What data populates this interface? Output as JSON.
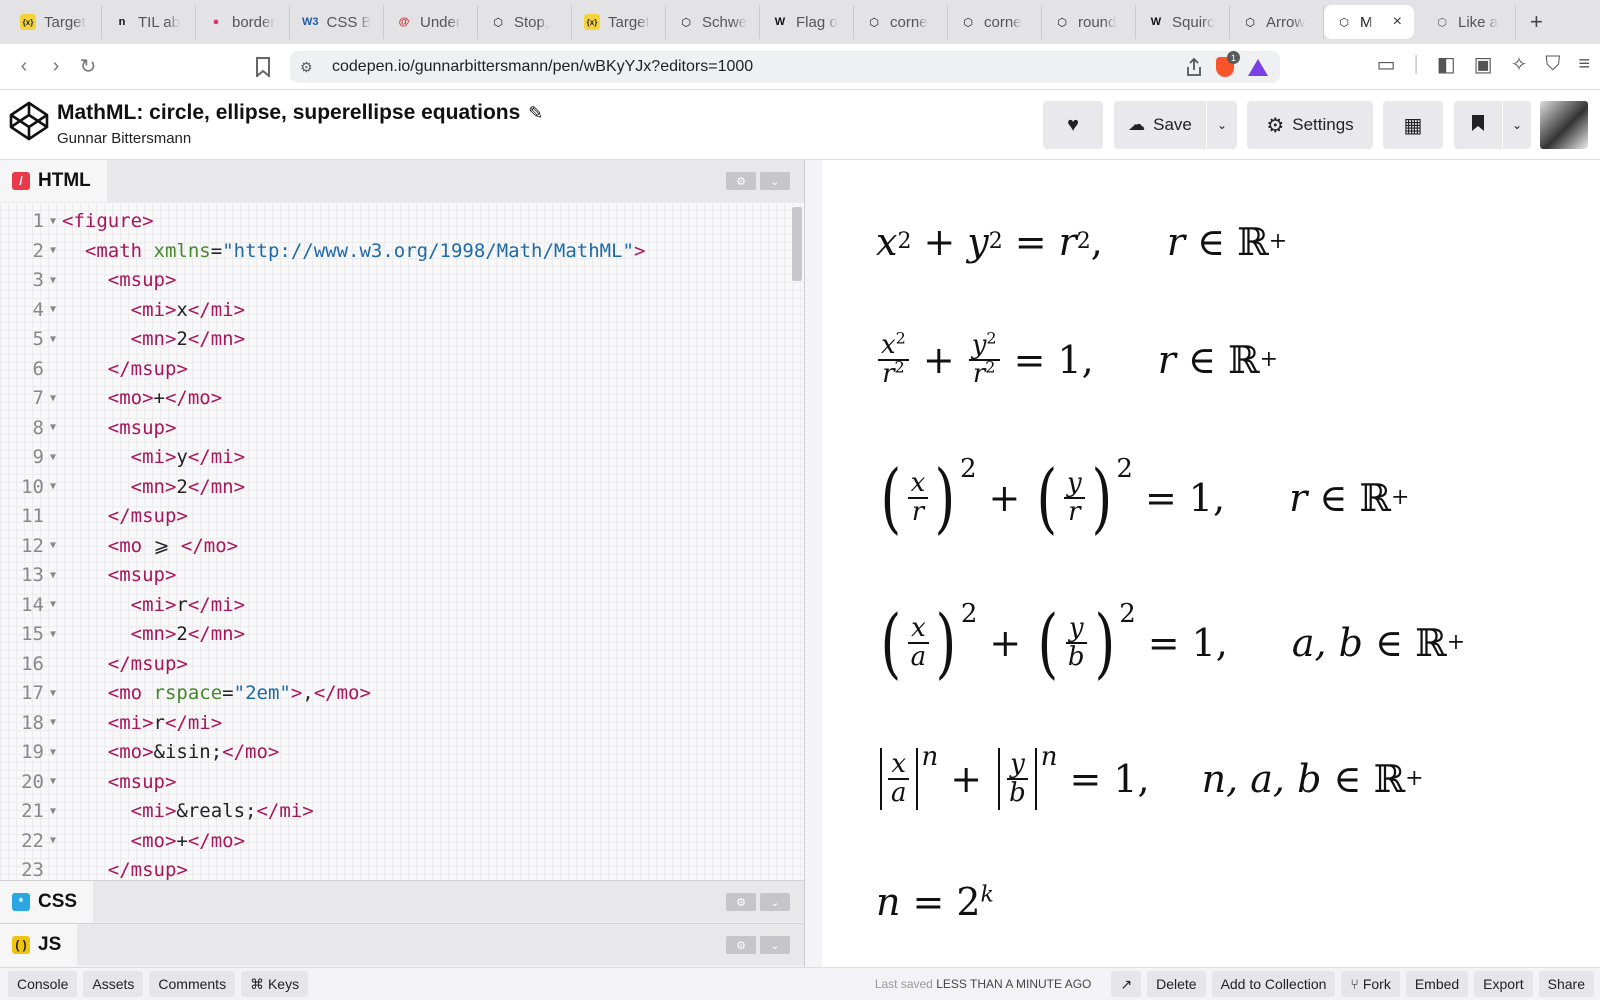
{
  "browser": {
    "tabs": [
      {
        "title": "Target",
        "icon": "bracket-x-icon",
        "color": "#f5d33a"
      },
      {
        "title": "TIL ab",
        "icon": "n-logo-icon",
        "color": "#111111"
      },
      {
        "title": "border",
        "icon": "pink-circle-icon",
        "color": "#e0336b"
      },
      {
        "title": "CSS B",
        "icon": "w3c-icon",
        "color": "#1e5aa8"
      },
      {
        "title": "Under",
        "icon": "red-swirl-icon",
        "color": "#d62a2a"
      },
      {
        "title": "Stop, ",
        "icon": "codepen-icon",
        "color": "#111111"
      },
      {
        "title": "Target",
        "icon": "bracket-x-icon",
        "color": "#f5d33a"
      },
      {
        "title": "Schwe",
        "icon": "codepen-icon",
        "color": "#111111"
      },
      {
        "title": "Flag o",
        "icon": "wikipedia-icon",
        "color": "#111111"
      },
      {
        "title": "corne",
        "icon": "codepen-icon",
        "color": "#111111"
      },
      {
        "title": "corne",
        "icon": "codepen-icon",
        "color": "#111111"
      },
      {
        "title": "round",
        "icon": "codepen-icon",
        "color": "#111111"
      },
      {
        "title": "Squirc",
        "icon": "wikipedia-icon",
        "color": "#111111"
      },
      {
        "title": "Arrow",
        "icon": "codepen-icon",
        "color": "#111111"
      }
    ],
    "active_tab": {
      "title": "M",
      "icon": "codepen-icon"
    },
    "last_tab": {
      "title": "Like a",
      "icon": "codepen-alt-icon"
    },
    "url": "codepen.io/gunnarbittersmann/pen/wBKyYJx?editors=1000",
    "brave_badge": "1"
  },
  "pen": {
    "title": "MathML: circle, ellipse, superellipse equations",
    "author": "Gunnar Bittersmann",
    "save_label": "Save",
    "settings_label": "Settings"
  },
  "panels": {
    "html_label": "HTML",
    "css_label": "CSS",
    "js_label": "JS"
  },
  "code_lines": [
    {
      "n": "1",
      "fold": true,
      "indent": "",
      "parts": [
        [
          "tg",
          "<figure>"
        ]
      ]
    },
    {
      "n": "2",
      "fold": true,
      "indent": "  ",
      "parts": [
        [
          "tg",
          "<math "
        ],
        [
          "at",
          "xmlns"
        ],
        [
          "tx",
          "="
        ],
        [
          "st",
          "\"http://www.w3.org/1998/Math/MathML\""
        ],
        [
          "tg",
          ">"
        ]
      ]
    },
    {
      "n": "3",
      "fold": true,
      "indent": "    ",
      "parts": [
        [
          "tg",
          "<msup>"
        ]
      ]
    },
    {
      "n": "4",
      "fold": true,
      "indent": "      ",
      "parts": [
        [
          "tg",
          "<mi>"
        ],
        [
          "tx",
          "x"
        ],
        [
          "tg",
          "</mi>"
        ]
      ]
    },
    {
      "n": "5",
      "fold": true,
      "indent": "      ",
      "parts": [
        [
          "tg",
          "<mn>"
        ],
        [
          "tx",
          "2"
        ],
        [
          "tg",
          "</mn>"
        ]
      ]
    },
    {
      "n": "6",
      "fold": false,
      "indent": "    ",
      "parts": [
        [
          "tg",
          "</msup>"
        ]
      ]
    },
    {
      "n": "7",
      "fold": true,
      "indent": "    ",
      "parts": [
        [
          "tg",
          "<mo>"
        ],
        [
          "tx",
          "+"
        ],
        [
          "tg",
          "</mo>"
        ]
      ]
    },
    {
      "n": "8",
      "fold": true,
      "indent": "    ",
      "parts": [
        [
          "tg",
          "<msup>"
        ]
      ]
    },
    {
      "n": "9",
      "fold": true,
      "indent": "      ",
      "parts": [
        [
          "tg",
          "<mi>"
        ],
        [
          "tx",
          "y"
        ],
        [
          "tg",
          "</mi>"
        ]
      ]
    },
    {
      "n": "10",
      "fold": true,
      "indent": "      ",
      "parts": [
        [
          "tg",
          "<mn>"
        ],
        [
          "tx",
          "2"
        ],
        [
          "tg",
          "</mn>"
        ]
      ]
    },
    {
      "n": "11",
      "fold": false,
      "indent": "    ",
      "parts": [
        [
          "tg",
          "</msup>"
        ]
      ]
    },
    {
      "n": "12",
      "fold": true,
      "indent": "    ",
      "parts": [
        [
          "tg",
          "<mo "
        ],
        [
          "tx",
          "⩾ "
        ],
        [
          "tg",
          "</mo>"
        ]
      ]
    },
    {
      "n": "13",
      "fold": true,
      "indent": "    ",
      "parts": [
        [
          "tg",
          "<msup>"
        ]
      ]
    },
    {
      "n": "14",
      "fold": true,
      "indent": "      ",
      "parts": [
        [
          "tg",
          "<mi>"
        ],
        [
          "tx",
          "r"
        ],
        [
          "tg",
          "</mi>"
        ]
      ]
    },
    {
      "n": "15",
      "fold": true,
      "indent": "      ",
      "parts": [
        [
          "tg",
          "<mn>"
        ],
        [
          "tx",
          "2"
        ],
        [
          "tg",
          "</mn>"
        ]
      ]
    },
    {
      "n": "16",
      "fold": false,
      "indent": "    ",
      "parts": [
        [
          "tg",
          "</msup>"
        ]
      ]
    },
    {
      "n": "17",
      "fold": true,
      "indent": "    ",
      "parts": [
        [
          "tg",
          "<mo "
        ],
        [
          "at",
          "rspace"
        ],
        [
          "tx",
          "="
        ],
        [
          "st",
          "\"2em\""
        ],
        [
          "tg",
          ">"
        ],
        [
          "tx",
          ","
        ],
        [
          "tg",
          "</mo>"
        ]
      ]
    },
    {
      "n": "18",
      "fold": true,
      "indent": "    ",
      "parts": [
        [
          "tg",
          "<mi>"
        ],
        [
          "tx",
          "r"
        ],
        [
          "tg",
          "</mi>"
        ]
      ]
    },
    {
      "n": "19",
      "fold": true,
      "indent": "    ",
      "parts": [
        [
          "tg",
          "<mo>"
        ],
        [
          "tx",
          "&isin;"
        ],
        [
          "tg",
          "</mo>"
        ]
      ]
    },
    {
      "n": "20",
      "fold": true,
      "indent": "    ",
      "parts": [
        [
          "tg",
          "<msup>"
        ]
      ]
    },
    {
      "n": "21",
      "fold": true,
      "indent": "      ",
      "parts": [
        [
          "tg",
          "<mi>"
        ],
        [
          "tx",
          "&reals;"
        ],
        [
          "tg",
          "</mi>"
        ]
      ]
    },
    {
      "n": "22",
      "fold": true,
      "indent": "      ",
      "parts": [
        [
          "tg",
          "<mo>"
        ],
        [
          "tx",
          "+"
        ],
        [
          "tg",
          "</mo>"
        ]
      ]
    },
    {
      "n": "23",
      "fold": false,
      "indent": "    ",
      "parts": [
        [
          "tg",
          "</msup>"
        ]
      ]
    }
  ],
  "preview": {
    "eq1": {
      "x": "x",
      "y": "y",
      "r": "r",
      "exp": "2",
      "eq": "=",
      "plus": "+",
      "comma": ",",
      "cond_var": "r",
      "in": "∈",
      "reals": "ℝ",
      "reals_sup": "+"
    },
    "eq2": {
      "num1": "x",
      "den1": "r",
      "num2": "y",
      "den2": "r",
      "exp": "2",
      "rhs": "1",
      "cond_var": "r"
    },
    "eq3": {
      "num1": "x",
      "den1": "r",
      "num2": "y",
      "den2": "r",
      "exp": "2",
      "rhs": "1",
      "cond_var": "r"
    },
    "eq4": {
      "num1": "x",
      "den1": "a",
      "num2": "y",
      "den2": "b",
      "exp": "2",
      "rhs": "1",
      "cond_var": "a, b"
    },
    "eq5": {
      "num1": "x",
      "den1": "a",
      "num2": "y",
      "den2": "b",
      "exp": "n",
      "rhs": "1",
      "cond_var": "n, a, b"
    },
    "eq6": {
      "lhs": "n",
      "base": "2",
      "exp": "k"
    }
  },
  "bottom": {
    "console": "Console",
    "assets": "Assets",
    "comments": "Comments",
    "keys": "⌘ Keys",
    "saved_prefix": "Last saved",
    "saved_time": "LESS THAN A MINUTE AGO",
    "delete": "Delete",
    "add_collection": "Add to Collection",
    "fork": "Fork",
    "embed": "Embed",
    "export": "Export",
    "share": "Share"
  }
}
